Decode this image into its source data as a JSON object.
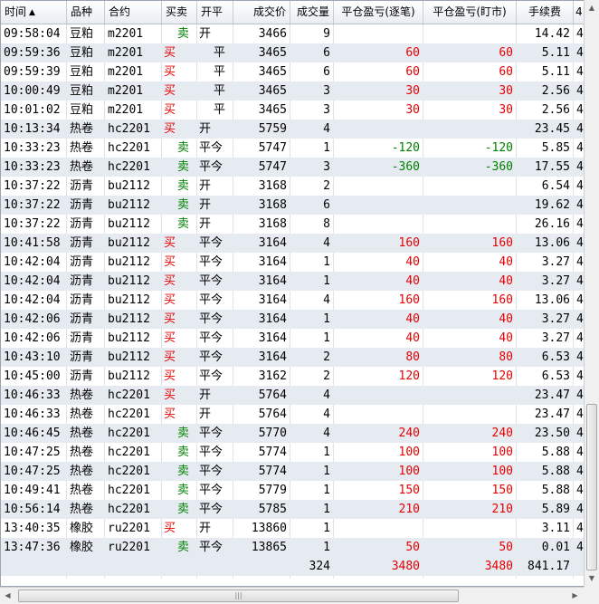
{
  "columns": {
    "time": "时间",
    "variety": "品种",
    "contract": "合约",
    "side": "买卖",
    "openclose": "开平",
    "price": "成交价",
    "volume": "成交量",
    "pnl_trade": "平仓盈亏(逐笔)",
    "pnl_mark": "平仓盈亏(盯市)",
    "fee": "手续费",
    "extra": "4"
  },
  "sort_indicator": "▲",
  "colors": {
    "buy": "#e60000",
    "sell": "#008000",
    "loss": "#008000",
    "profit": "#e60000"
  },
  "rows": [
    {
      "time": "09:58:04",
      "variety": "豆粕",
      "contract": "m2201",
      "side": "卖",
      "oc": "开",
      "price": "3466",
      "vol": "9",
      "p1": "",
      "p2": "",
      "fee": "14.42",
      "extra": "4"
    },
    {
      "time": "09:59:36",
      "variety": "豆粕",
      "contract": "m2201",
      "side": "买",
      "oc": "平",
      "price": "3465",
      "vol": "6",
      "p1": "60",
      "p2": "60",
      "fee": "5.11",
      "extra": "4"
    },
    {
      "time": "09:59:39",
      "variety": "豆粕",
      "contract": "m2201",
      "side": "买",
      "oc": "平",
      "price": "3465",
      "vol": "6",
      "p1": "60",
      "p2": "60",
      "fee": "5.11",
      "extra": "4"
    },
    {
      "time": "10:00:49",
      "variety": "豆粕",
      "contract": "m2201",
      "side": "买",
      "oc": "平",
      "price": "3465",
      "vol": "3",
      "p1": "30",
      "p2": "30",
      "fee": "2.56",
      "extra": "4"
    },
    {
      "time": "10:01:02",
      "variety": "豆粕",
      "contract": "m2201",
      "side": "买",
      "oc": "平",
      "price": "3465",
      "vol": "3",
      "p1": "30",
      "p2": "30",
      "fee": "2.56",
      "extra": "4"
    },
    {
      "time": "10:13:34",
      "variety": "热卷",
      "contract": "hc2201",
      "side": "买",
      "oc": "开",
      "price": "5759",
      "vol": "4",
      "p1": "",
      "p2": "",
      "fee": "23.45",
      "extra": "4"
    },
    {
      "time": "10:33:23",
      "variety": "热卷",
      "contract": "hc2201",
      "side": "卖",
      "oc": "平今",
      "price": "5747",
      "vol": "1",
      "p1": "-120",
      "p2": "-120",
      "fee": "5.85",
      "extra": "4"
    },
    {
      "time": "10:33:23",
      "variety": "热卷",
      "contract": "hc2201",
      "side": "卖",
      "oc": "平今",
      "price": "5747",
      "vol": "3",
      "p1": "-360",
      "p2": "-360",
      "fee": "17.55",
      "extra": "4"
    },
    {
      "time": "10:37:22",
      "variety": "沥青",
      "contract": "bu2112",
      "side": "卖",
      "oc": "开",
      "price": "3168",
      "vol": "2",
      "p1": "",
      "p2": "",
      "fee": "6.54",
      "extra": "4"
    },
    {
      "time": "10:37:22",
      "variety": "沥青",
      "contract": "bu2112",
      "side": "卖",
      "oc": "开",
      "price": "3168",
      "vol": "6",
      "p1": "",
      "p2": "",
      "fee": "19.62",
      "extra": "4"
    },
    {
      "time": "10:37:22",
      "variety": "沥青",
      "contract": "bu2112",
      "side": "卖",
      "oc": "开",
      "price": "3168",
      "vol": "8",
      "p1": "",
      "p2": "",
      "fee": "26.16",
      "extra": "4"
    },
    {
      "time": "10:41:58",
      "variety": "沥青",
      "contract": "bu2112",
      "side": "买",
      "oc": "平今",
      "price": "3164",
      "vol": "4",
      "p1": "160",
      "p2": "160",
      "fee": "13.06",
      "extra": "4"
    },
    {
      "time": "10:42:04",
      "variety": "沥青",
      "contract": "bu2112",
      "side": "买",
      "oc": "平今",
      "price": "3164",
      "vol": "1",
      "p1": "40",
      "p2": "40",
      "fee": "3.27",
      "extra": "4"
    },
    {
      "time": "10:42:04",
      "variety": "沥青",
      "contract": "bu2112",
      "side": "买",
      "oc": "平今",
      "price": "3164",
      "vol": "1",
      "p1": "40",
      "p2": "40",
      "fee": "3.27",
      "extra": "4"
    },
    {
      "time": "10:42:04",
      "variety": "沥青",
      "contract": "bu2112",
      "side": "买",
      "oc": "平今",
      "price": "3164",
      "vol": "4",
      "p1": "160",
      "p2": "160",
      "fee": "13.06",
      "extra": "4"
    },
    {
      "time": "10:42:06",
      "variety": "沥青",
      "contract": "bu2112",
      "side": "买",
      "oc": "平今",
      "price": "3164",
      "vol": "1",
      "p1": "40",
      "p2": "40",
      "fee": "3.27",
      "extra": "4"
    },
    {
      "time": "10:42:06",
      "variety": "沥青",
      "contract": "bu2112",
      "side": "买",
      "oc": "平今",
      "price": "3164",
      "vol": "1",
      "p1": "40",
      "p2": "40",
      "fee": "3.27",
      "extra": "4"
    },
    {
      "time": "10:43:10",
      "variety": "沥青",
      "contract": "bu2112",
      "side": "买",
      "oc": "平今",
      "price": "3164",
      "vol": "2",
      "p1": "80",
      "p2": "80",
      "fee": "6.53",
      "extra": "4"
    },
    {
      "time": "10:45:00",
      "variety": "沥青",
      "contract": "bu2112",
      "side": "买",
      "oc": "平今",
      "price": "3162",
      "vol": "2",
      "p1": "120",
      "p2": "120",
      "fee": "6.53",
      "extra": "4"
    },
    {
      "time": "10:46:33",
      "variety": "热卷",
      "contract": "hc2201",
      "side": "买",
      "oc": "开",
      "price": "5764",
      "vol": "4",
      "p1": "",
      "p2": "",
      "fee": "23.47",
      "extra": "4"
    },
    {
      "time": "10:46:33",
      "variety": "热卷",
      "contract": "hc2201",
      "side": "买",
      "oc": "开",
      "price": "5764",
      "vol": "4",
      "p1": "",
      "p2": "",
      "fee": "23.47",
      "extra": "4"
    },
    {
      "time": "10:46:45",
      "variety": "热卷",
      "contract": "hc2201",
      "side": "卖",
      "oc": "平今",
      "price": "5770",
      "vol": "4",
      "p1": "240",
      "p2": "240",
      "fee": "23.50",
      "extra": "4"
    },
    {
      "time": "10:47:25",
      "variety": "热卷",
      "contract": "hc2201",
      "side": "卖",
      "oc": "平今",
      "price": "5774",
      "vol": "1",
      "p1": "100",
      "p2": "100",
      "fee": "5.88",
      "extra": "4"
    },
    {
      "time": "10:47:25",
      "variety": "热卷",
      "contract": "hc2201",
      "side": "卖",
      "oc": "平今",
      "price": "5774",
      "vol": "1",
      "p1": "100",
      "p2": "100",
      "fee": "5.88",
      "extra": "4"
    },
    {
      "time": "10:49:41",
      "variety": "热卷",
      "contract": "hc2201",
      "side": "卖",
      "oc": "平今",
      "price": "5779",
      "vol": "1",
      "p1": "150",
      "p2": "150",
      "fee": "5.88",
      "extra": "4"
    },
    {
      "time": "10:56:14",
      "variety": "热卷",
      "contract": "hc2201",
      "side": "卖",
      "oc": "平今",
      "price": "5785",
      "vol": "1",
      "p1": "210",
      "p2": "210",
      "fee": "5.89",
      "extra": "4"
    },
    {
      "time": "13:40:35",
      "variety": "橡胶",
      "contract": "ru2201",
      "side": "买",
      "oc": "开",
      "price": "13860",
      "vol": "1",
      "p1": "",
      "p2": "",
      "fee": "3.11",
      "extra": "4"
    },
    {
      "time": "13:47:36",
      "variety": "橡胶",
      "contract": "ru2201",
      "side": "卖",
      "oc": "平今",
      "price": "13865",
      "vol": "1",
      "p1": "50",
      "p2": "50",
      "fee": "0.01",
      "extra": "4"
    }
  ],
  "totals": {
    "vol": "324",
    "p1": "3480",
    "p2": "3480",
    "fee": "841.17"
  },
  "scrollbar": {
    "up": "▲",
    "down": "▼",
    "left": "◀",
    "right": "▶",
    "grip": "|||"
  }
}
